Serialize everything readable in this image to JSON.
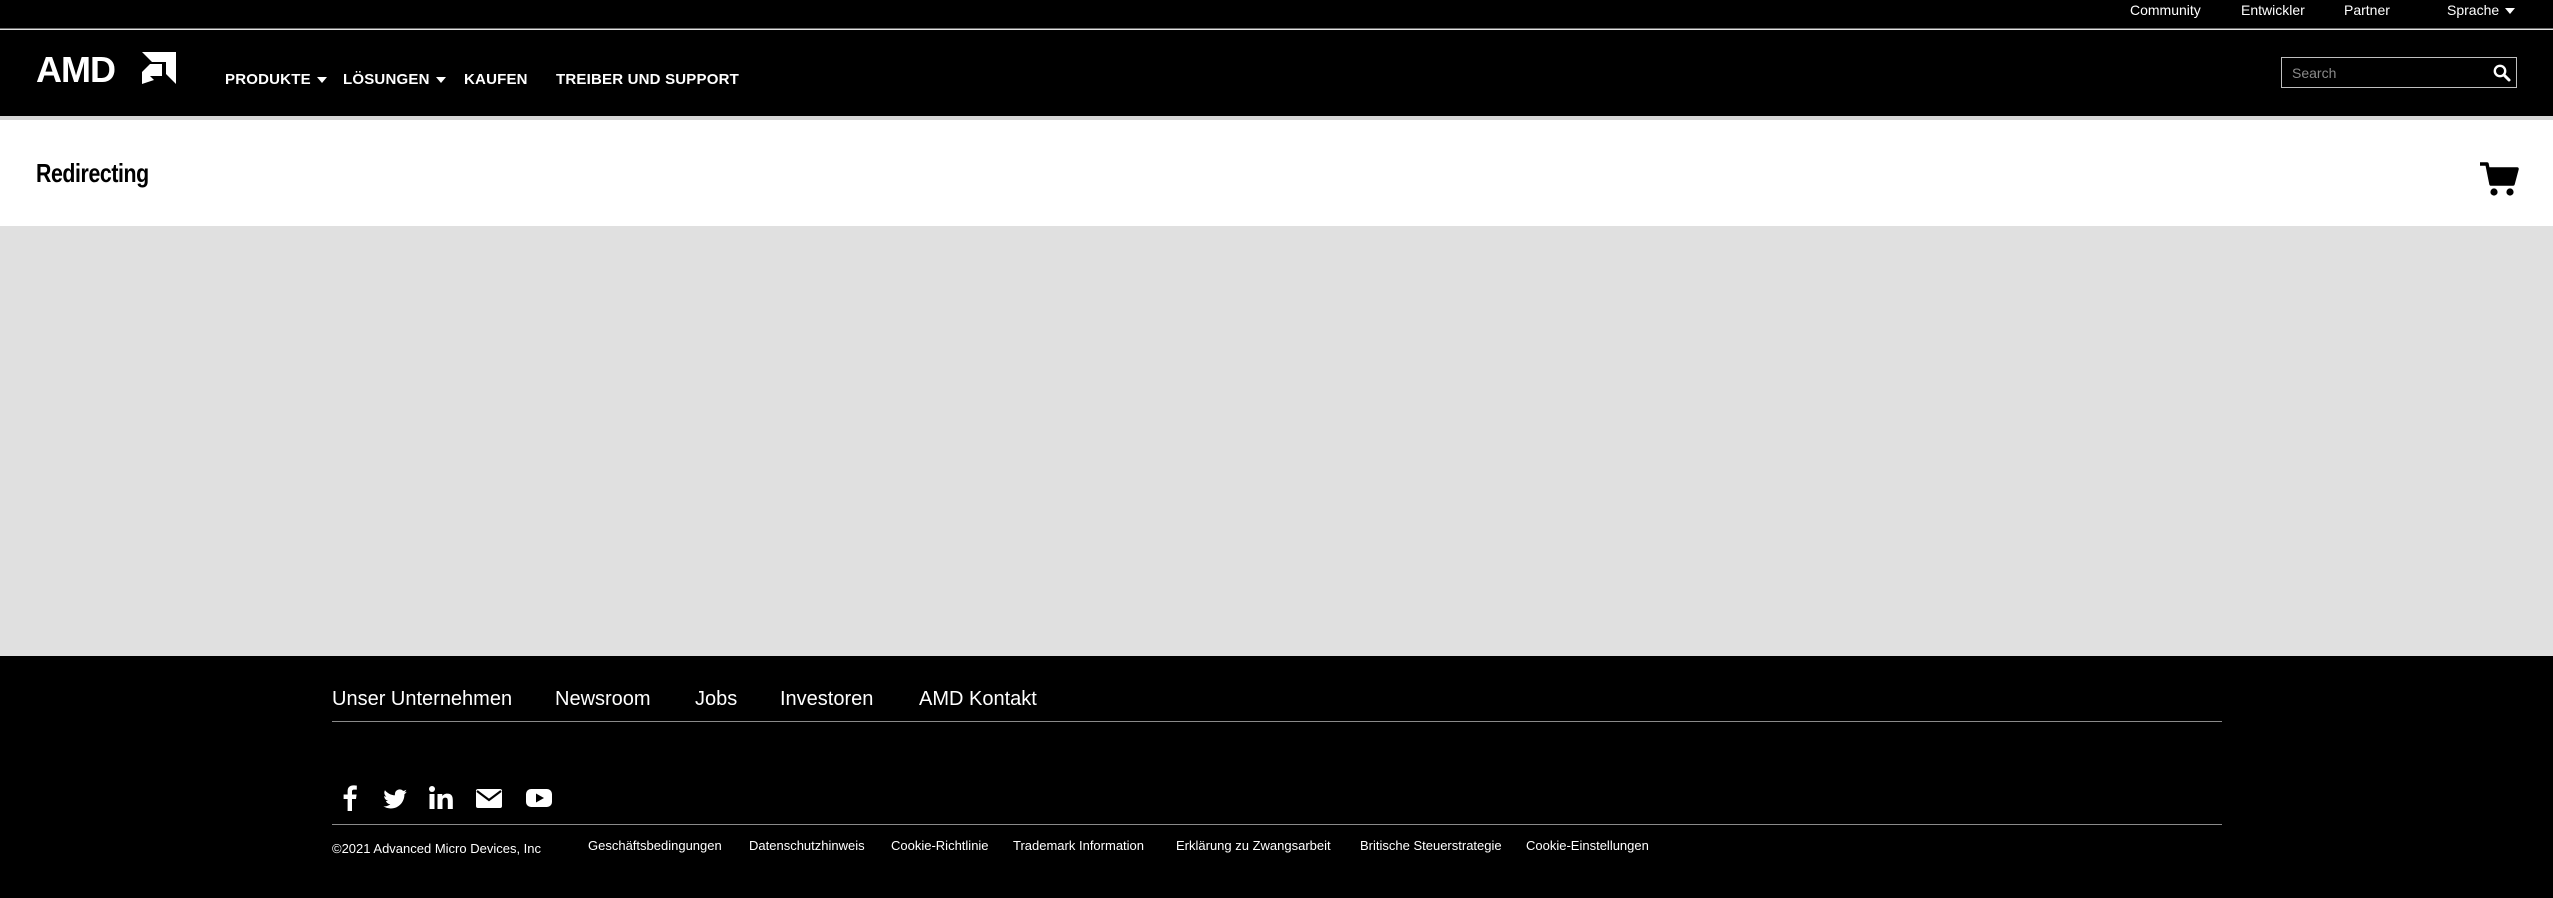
{
  "utility_nav": {
    "community": "Community",
    "developers": "Entwickler",
    "partner": "Partner",
    "language": "Sprache"
  },
  "main_nav": {
    "logo_text": "AMD",
    "items": [
      "PRODUKTE",
      "LÖSUNGEN",
      "KAUFEN",
      "TREIBER UND SUPPORT"
    ],
    "search_placeholder": "Search"
  },
  "page": {
    "title": "Redirecting"
  },
  "footer": {
    "nav": [
      "Unser Unternehmen",
      "Newsroom",
      "Jobs",
      "Investoren",
      "AMD Kontakt"
    ],
    "social": [
      "facebook-icon",
      "twitter-icon",
      "linkedin-icon",
      "email-icon",
      "youtube-icon"
    ],
    "copyright": "©2021 Advanced Micro Devices, Inc",
    "legal": [
      "Geschäftsbedingungen",
      "Datenschutzhinweis",
      "Cookie-Richtlinie",
      "Trademark Information",
      "Erklärung zu Zwangsarbeit",
      "Britische Steuerstrategie",
      "Cookie-Einstellungen"
    ]
  },
  "colors": {
    "header_bg": "#000000",
    "content_bg": "#e0e0e0",
    "title_band_bg": "#ffffff",
    "text_light": "#ffffff"
  }
}
